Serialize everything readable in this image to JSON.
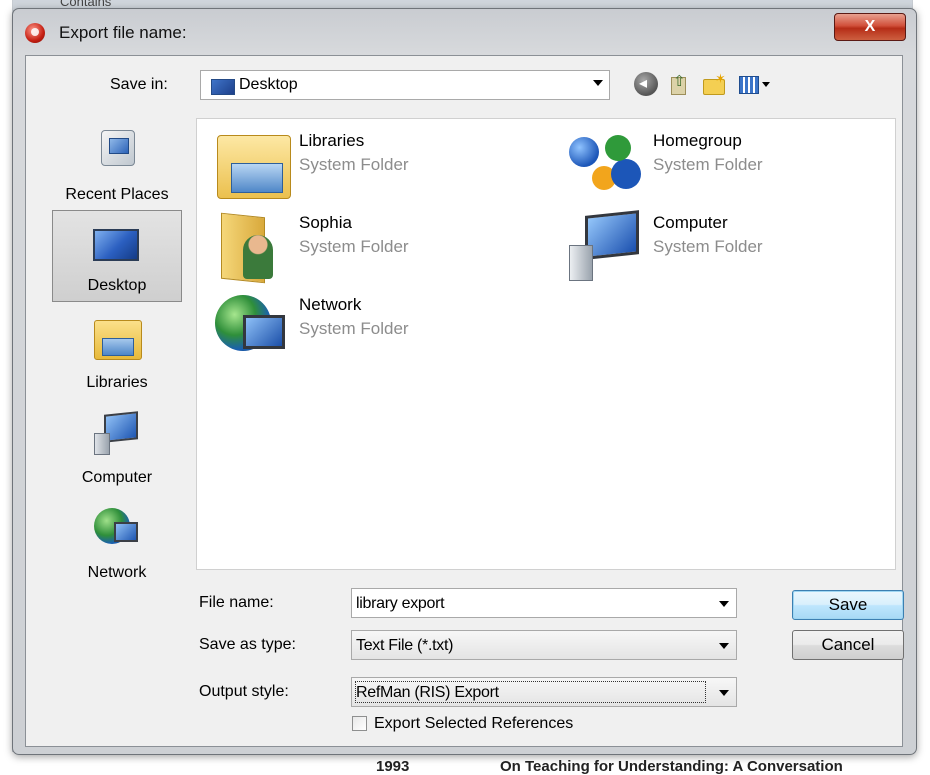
{
  "background": {
    "contains_label": "Contains",
    "bottom_year": "1993",
    "bottom_title": "On Teaching for Understanding: A Conversation"
  },
  "dialog": {
    "title": "Export file name:",
    "close_label": "X"
  },
  "save_in": {
    "label": "Save in:",
    "value": "Desktop"
  },
  "toolbar": {
    "icons": [
      "back-icon",
      "up-folder-icon",
      "new-folder-icon",
      "views-menu-icon"
    ]
  },
  "places": [
    {
      "label": "Recent Places",
      "icon": "recent-places-icon"
    },
    {
      "label": "Desktop",
      "icon": "desktop-icon",
      "selected": true
    },
    {
      "label": "Libraries",
      "icon": "libraries-icon"
    },
    {
      "label": "Computer",
      "icon": "computer-icon"
    },
    {
      "label": "Network",
      "icon": "network-icon"
    }
  ],
  "files": [
    {
      "name": "Libraries",
      "type": "System Folder",
      "icon": "libraries-folder-icon"
    },
    {
      "name": "Homegroup",
      "type": "System Folder",
      "icon": "homegroup-icon"
    },
    {
      "name": "Sophia",
      "type": "System Folder",
      "icon": "user-folder-icon"
    },
    {
      "name": "Computer",
      "type": "System Folder",
      "icon": "computer-icon"
    },
    {
      "name": "Network",
      "type": "System Folder",
      "icon": "network-icon"
    }
  ],
  "form": {
    "file_name_label": "File name:",
    "file_name_value": "library export",
    "save_as_type_label": "Save as type:",
    "save_as_type_value": "Text File (*.txt)",
    "output_style_label": "Output style:",
    "output_style_value": "RefMan (RIS) Export",
    "export_selected_label": "Export Selected References",
    "export_selected_checked": false
  },
  "buttons": {
    "save": "Save",
    "cancel": "Cancel"
  }
}
